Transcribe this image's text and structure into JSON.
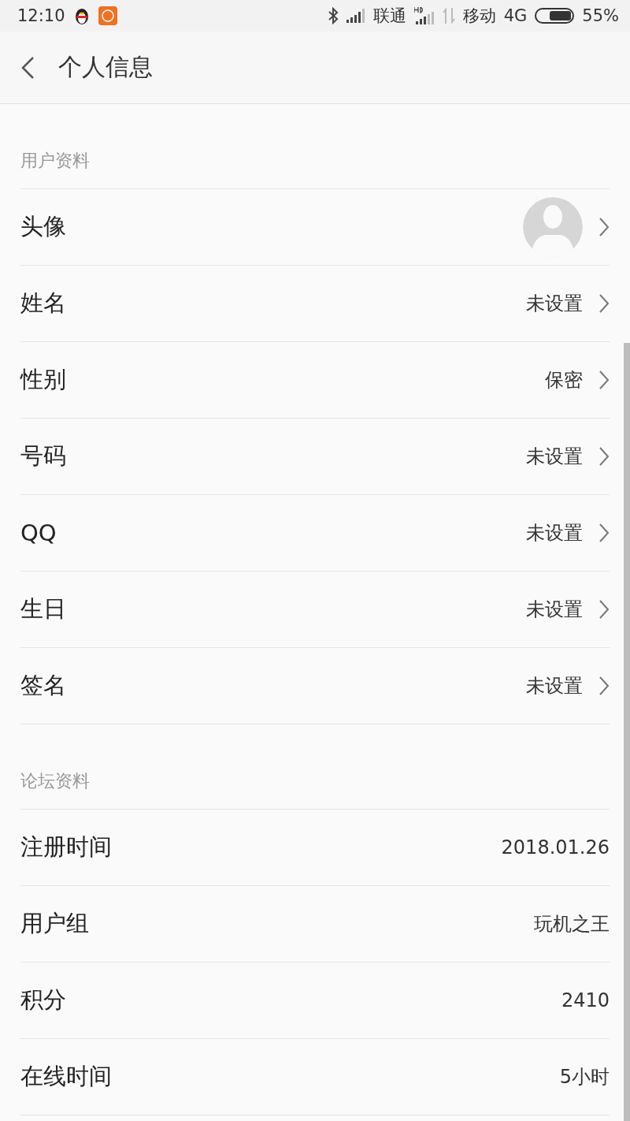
{
  "status_bar": {
    "time": "12:10",
    "carrier_1": "联通",
    "carrier_2": "移动",
    "network": "4G",
    "battery": "55%"
  },
  "header": {
    "title": "个人信息"
  },
  "sections": [
    {
      "title": "用户资料",
      "rows": [
        {
          "kind": "avatar",
          "label": "头像"
        },
        {
          "kind": "link",
          "label": "姓名",
          "value": "未设置"
        },
        {
          "kind": "link",
          "label": "性别",
          "value": "保密"
        },
        {
          "kind": "link",
          "label": "号码",
          "value": "未设置"
        },
        {
          "kind": "link",
          "label": "QQ",
          "value": "未设置"
        },
        {
          "kind": "link",
          "label": "生日",
          "value": "未设置"
        },
        {
          "kind": "link",
          "label": "签名",
          "value": "未设置"
        }
      ]
    },
    {
      "title": "论坛资料",
      "rows": [
        {
          "kind": "info",
          "label": "注册时间",
          "value": "2018.01.26"
        },
        {
          "kind": "info",
          "label": "用户组",
          "value": "玩机之王"
        },
        {
          "kind": "info",
          "label": "积分",
          "value": "2410"
        },
        {
          "kind": "info",
          "label": "在线时间",
          "value": "5小时"
        }
      ]
    }
  ]
}
